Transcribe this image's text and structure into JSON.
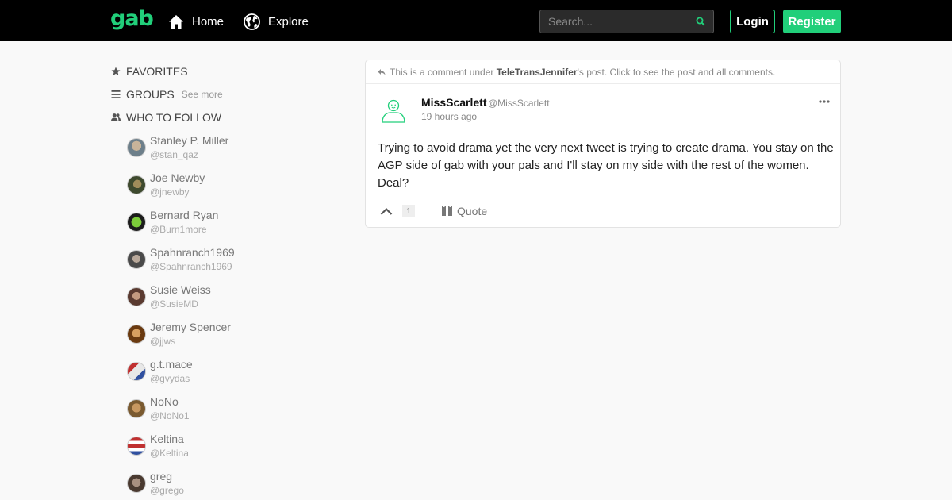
{
  "header": {
    "logo": "gab",
    "nav": [
      {
        "label": "Home",
        "icon": "home-icon"
      },
      {
        "label": "Explore",
        "icon": "globe-icon"
      }
    ],
    "search_placeholder": "Search...",
    "login_label": "Login",
    "register_label": "Register",
    "accent_color": "#21cf7a"
  },
  "sidebar": {
    "favorites_label": "FAVORITES",
    "groups_label": "GROUPS",
    "see_more_label": "See more",
    "who_to_follow_label": "WHO TO FOLLOW",
    "follow": [
      {
        "name": "Stanley P. Miller",
        "handle": "@stan_qaz"
      },
      {
        "name": "Joe Newby",
        "handle": "@jnewby"
      },
      {
        "name": "Bernard Ryan",
        "handle": "@Burn1more"
      },
      {
        "name": "Spahnranch1969",
        "handle": "@Spahnranch1969"
      },
      {
        "name": "Susie Weiss",
        "handle": "@SusieMD"
      },
      {
        "name": "Jeremy Spencer",
        "handle": "@jjws"
      },
      {
        "name": "g.t.mace",
        "handle": "@gvydas"
      },
      {
        "name": "NoNo",
        "handle": "@NoNo1"
      },
      {
        "name": "Keltina",
        "handle": "@Keltina"
      },
      {
        "name": "greg",
        "handle": "@grego"
      }
    ]
  },
  "post": {
    "notice_prefix": "This is a comment under",
    "notice_user": "TeleTransJennifer",
    "notice_suffix": "'s post. Click to see the post and all comments.",
    "author_name": "MissScarlett",
    "author_handle": "@MissScarlett",
    "time": "19 hours ago",
    "body": "Trying to avoid drama yet the very next tweet is trying to create drama. You stay on the AGP side of gab with your pals and I'll stay on my side with the rest of the women. Deal?",
    "upvote_count": "1",
    "quote_label": "Quote"
  }
}
